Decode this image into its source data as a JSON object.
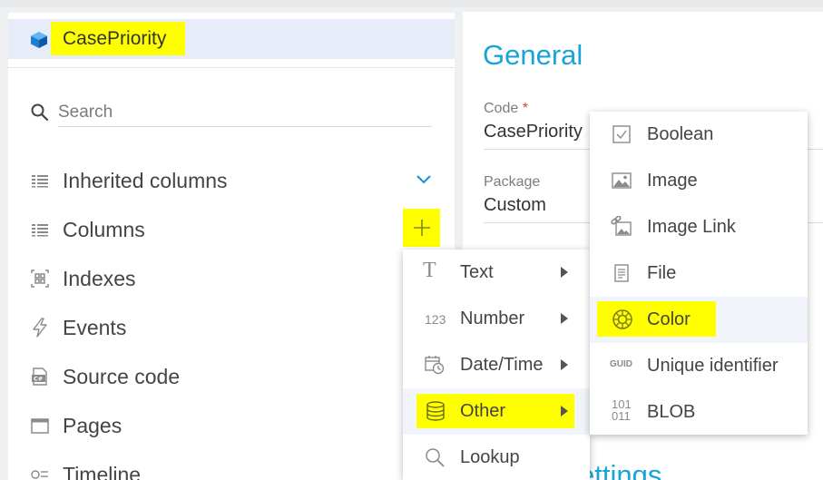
{
  "object": {
    "title": "CasePriority",
    "icon": "cube-icon"
  },
  "search": {
    "placeholder": "Search"
  },
  "nav": [
    {
      "label": "Inherited columns",
      "icon": "list-icon",
      "expand": "chevron-down-icon"
    },
    {
      "label": "Columns",
      "icon": "list-icon",
      "action": "plus-icon"
    },
    {
      "label": "Indexes",
      "icon": "index-icon"
    },
    {
      "label": "Events",
      "icon": "lightning-icon"
    },
    {
      "label": "Source code",
      "icon": "csharp-file-icon"
    },
    {
      "label": "Pages",
      "icon": "window-icon"
    },
    {
      "label": "Timeline",
      "icon": "timeline-icon"
    }
  ],
  "general": {
    "title": "General",
    "code_label": "Code",
    "required_mark": "*",
    "code_value": "CasePriority",
    "package_label": "Package",
    "package_value": "Custom",
    "settings_title": "ettings"
  },
  "column_type_menu": [
    {
      "label": "Text",
      "icon": "text-T-icon"
    },
    {
      "label": "Number",
      "icon": "number-123-icon",
      "icon_text": "123"
    },
    {
      "label": "Date/Time",
      "icon": "calendar-clock-icon"
    },
    {
      "label": "Other",
      "icon": "database-icon",
      "active": true
    },
    {
      "label": "Lookup",
      "icon": "magnifier-icon"
    }
  ],
  "other_submenu": [
    {
      "label": "Boolean",
      "icon": "checkbox-icon"
    },
    {
      "label": "Image",
      "icon": "image-icon"
    },
    {
      "label": "Image Link",
      "icon": "image-link-icon"
    },
    {
      "label": "File",
      "icon": "file-icon"
    },
    {
      "label": "Color",
      "icon": "color-wheel-icon",
      "active": true
    },
    {
      "label": "Unique identifier",
      "icon": "guid-icon",
      "icon_text": "GUID"
    },
    {
      "label": "BLOB",
      "icon": "binary-icon",
      "icon_text": "101\n011"
    }
  ],
  "colors": {
    "accent": "#17a4d9",
    "highlight": "#ffff00",
    "header_bg": "#e7ecf9",
    "required": "#e53935"
  }
}
